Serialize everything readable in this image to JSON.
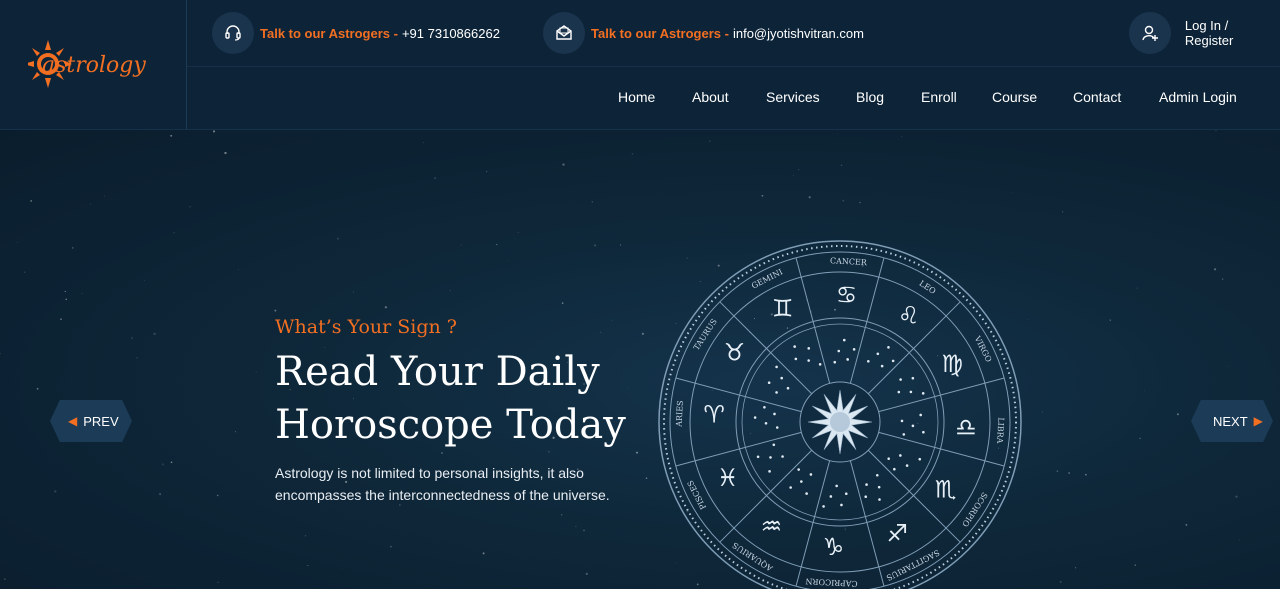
{
  "brand": {
    "logo_text": "astrology",
    "accent": "#f26f22"
  },
  "topbar": {
    "phone": {
      "label": "Talk to our Astrogers -",
      "value": "+91 7310866262",
      "icon": "headset-icon"
    },
    "email": {
      "label": "Talk to our Astrogers -",
      "value": "info@jyotishvitran.com",
      "icon": "mail-icon"
    },
    "login": {
      "label": "Log In / Register",
      "icon": "user-plus-icon"
    }
  },
  "nav": {
    "items": [
      "Home",
      "About",
      "Services",
      "Blog",
      "Enroll",
      "Course",
      "Contact",
      "Admin Login"
    ]
  },
  "hero": {
    "eyebrow": "What’s Your Sign ?",
    "title_line1": "Read Your Daily",
    "title_line2": "Horoscope Today",
    "subtitle_line1": "Astrology is not limited to personal insights, it also",
    "subtitle_line2": "encompasses the interconnectedness of the universe.",
    "prev_label": "PREV",
    "next_label": "NEXT"
  },
  "zodiac": {
    "signs": [
      "CANCER",
      "LEO",
      "VIRGO",
      "LIBRA",
      "SCORPIO",
      "SAGITTARIUS",
      "CAPRICORN",
      "AQUARIUS",
      "PISCES",
      "ARIES",
      "TAURUS",
      "GEMINI"
    ],
    "glyphs": [
      "♋",
      "♌",
      "♍",
      "♎",
      "♏",
      "♐",
      "♑",
      "♒",
      "♓",
      "♈",
      "♉",
      "♊"
    ]
  }
}
